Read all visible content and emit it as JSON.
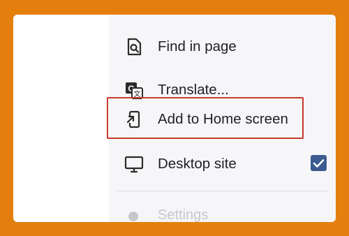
{
  "menu": {
    "items": [
      {
        "label": "Find in page",
        "icon": "find-in-page-icon"
      },
      {
        "label": "Translate...",
        "icon": "translate-icon"
      },
      {
        "label": "Add to Home screen",
        "icon": "add-to-home-screen-icon",
        "highlighted": true
      },
      {
        "label": "Desktop site",
        "icon": "desktop-icon",
        "checked": true
      }
    ],
    "partial_item": {
      "label": "Settings",
      "icon": "settings-icon"
    }
  },
  "colors": {
    "frame": "#e47f0e",
    "highlight_border": "#c8392b",
    "checkbox": "#3b5a8f"
  }
}
